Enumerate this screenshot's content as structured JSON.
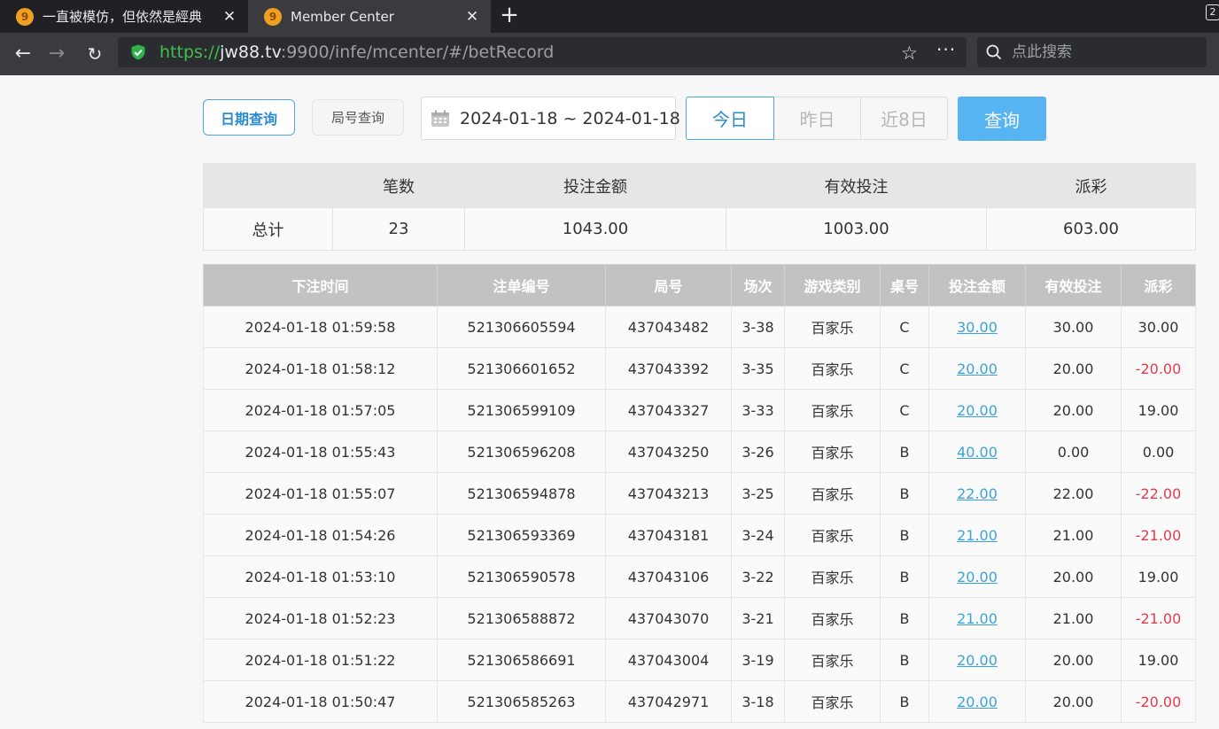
{
  "browser": {
    "tabs": [
      {
        "title": "一直被模仿，但依然是經典",
        "favicon": "lottery-logo-icon"
      },
      {
        "title": "Member Center",
        "favicon": "lottery-logo-icon"
      }
    ],
    "tab_count": "2",
    "url": {
      "proto": "https://",
      "host": "jw88.tv",
      "rest": ":9900/infe/mcenter/#/betRecord"
    },
    "search_placeholder": "点此搜索"
  },
  "filters": {
    "date_query": "日期查询",
    "round_query": "局号查询",
    "date_range": "2024-01-18 ~ 2024-01-18",
    "quick": [
      "今日",
      "昨日",
      "近8日"
    ],
    "query": "查询"
  },
  "summary": {
    "headers": [
      "",
      "笔数",
      "投注金额",
      "有效投注",
      "派彩"
    ],
    "row": [
      "总计",
      "23",
      "1043.00",
      "1003.00",
      "603.00"
    ]
  },
  "records": {
    "headers": [
      "下注时间",
      "注单编号",
      "局号",
      "场次",
      "游戏类别",
      "桌号",
      "投注金额",
      "有效投注",
      "派彩"
    ],
    "rows": [
      [
        "2024-01-18 01:59:58",
        "521306605594",
        "437043482",
        "3-38",
        "百家乐",
        "C",
        "30.00",
        "30.00",
        "30.00"
      ],
      [
        "2024-01-18 01:58:12",
        "521306601652",
        "437043392",
        "3-35",
        "百家乐",
        "C",
        "20.00",
        "20.00",
        "-20.00"
      ],
      [
        "2024-01-18 01:57:05",
        "521306599109",
        "437043327",
        "3-33",
        "百家乐",
        "C",
        "20.00",
        "20.00",
        "19.00"
      ],
      [
        "2024-01-18 01:55:43",
        "521306596208",
        "437043250",
        "3-26",
        "百家乐",
        "B",
        "40.00",
        "0.00",
        "0.00"
      ],
      [
        "2024-01-18 01:55:07",
        "521306594878",
        "437043213",
        "3-25",
        "百家乐",
        "B",
        "22.00",
        "22.00",
        "-22.00"
      ],
      [
        "2024-01-18 01:54:26",
        "521306593369",
        "437043181",
        "3-24",
        "百家乐",
        "B",
        "21.00",
        "21.00",
        "-21.00"
      ],
      [
        "2024-01-18 01:53:10",
        "521306590578",
        "437043106",
        "3-22",
        "百家乐",
        "B",
        "20.00",
        "20.00",
        "19.00"
      ],
      [
        "2024-01-18 01:52:23",
        "521306588872",
        "437043070",
        "3-21",
        "百家乐",
        "B",
        "21.00",
        "21.00",
        "-21.00"
      ],
      [
        "2024-01-18 01:51:22",
        "521306586691",
        "437043004",
        "3-19",
        "百家乐",
        "B",
        "20.00",
        "20.00",
        "19.00"
      ],
      [
        "2024-01-18 01:50:47",
        "521306585263",
        "437042971",
        "3-18",
        "百家乐",
        "B",
        "20.00",
        "20.00",
        "-20.00"
      ]
    ]
  },
  "colors": {
    "accent": "#55b4f1",
    "link": "#3aa3dd",
    "negative": "#e33b4a",
    "header_bg": "#c2c2c2"
  }
}
